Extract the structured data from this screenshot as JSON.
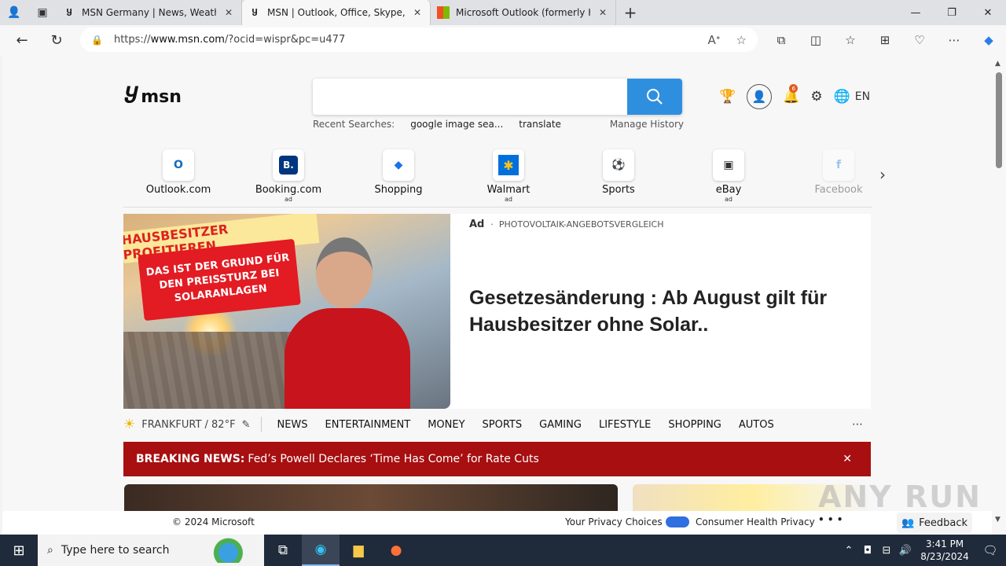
{
  "browser": {
    "tabs": [
      {
        "title": "MSN Germany | News, Weather,",
        "active": false
      },
      {
        "title": "MSN | Outlook, Office, Skype, Bin",
        "active": true
      },
      {
        "title": "Microsoft Outlook (formerly Hot",
        "active": false
      }
    ],
    "url_prefix": "https://",
    "url_domain": "www.msn.com",
    "url_rest": "/?ocid=wispr&pc=u477"
  },
  "msn": {
    "logo_text": "msn",
    "recent_label": "Recent Searches:",
    "recent_items": [
      "google image sea...",
      "translate"
    ],
    "manage_history": "Manage History",
    "notification_count": "6",
    "language": "EN"
  },
  "quick_links": [
    {
      "label": "Outlook.com",
      "ad": "",
      "icon": "outlook-icon",
      "color": "#0f6cbd",
      "glyph": "O"
    },
    {
      "label": "Booking.com",
      "ad": "ad",
      "icon": "booking-icon",
      "color": "#003580",
      "glyph": "B."
    },
    {
      "label": "Shopping",
      "ad": "",
      "icon": "shopping-tag-icon",
      "color": "#1a73e8",
      "glyph": "◆"
    },
    {
      "label": "Walmart",
      "ad": "ad",
      "icon": "walmart-icon",
      "color": "#0071dc",
      "glyph": "✱"
    },
    {
      "label": "Sports",
      "ad": "",
      "icon": "sports-icon",
      "color": "#3b2a8a",
      "glyph": "⚽"
    },
    {
      "label": "eBay",
      "ad": "ad",
      "icon": "ebay-icon",
      "color": "#333333",
      "glyph": "▣"
    },
    {
      "label": "Facebook",
      "ad": "",
      "icon": "facebook-icon",
      "color": "#1877f2",
      "glyph": "f"
    }
  ],
  "hero": {
    "ad_badge": "Ad",
    "ad_source": "PHOTOVOLTAIK-ANGEBOTSVERGLEICH",
    "headline": "Gesetzesänderung : Ab August gilt für Hausbesitzer ohne Solar..",
    "banner_top": "HAUSBESITZER PROFITIEREN",
    "banner_main": "DAS IST DER GRUND FÜR DEN PREISSTURZ BEI SOLARANLAGEN"
  },
  "weather": {
    "city_temp": "FRANKFURT / 82°F"
  },
  "nav_items": [
    "NEWS",
    "ENTERTAINMENT",
    "MONEY",
    "SPORTS",
    "GAMING",
    "LIFESTYLE",
    "SHOPPING",
    "AUTOS"
  ],
  "breaking": {
    "label": "BREAKING NEWS:",
    "text": "Fed’s Powell Declares ‘Time Has Come’ for Rate Cuts"
  },
  "footer": {
    "copyright": "© 2024 Microsoft",
    "privacy": "Your Privacy Choices",
    "health": "Consumer Health Privacy",
    "feedback": "Feedback"
  },
  "taskbar": {
    "search_placeholder": "Type here to search",
    "time": "3:41 PM",
    "date": "8/23/2024"
  },
  "watermark": "ANY RUN"
}
